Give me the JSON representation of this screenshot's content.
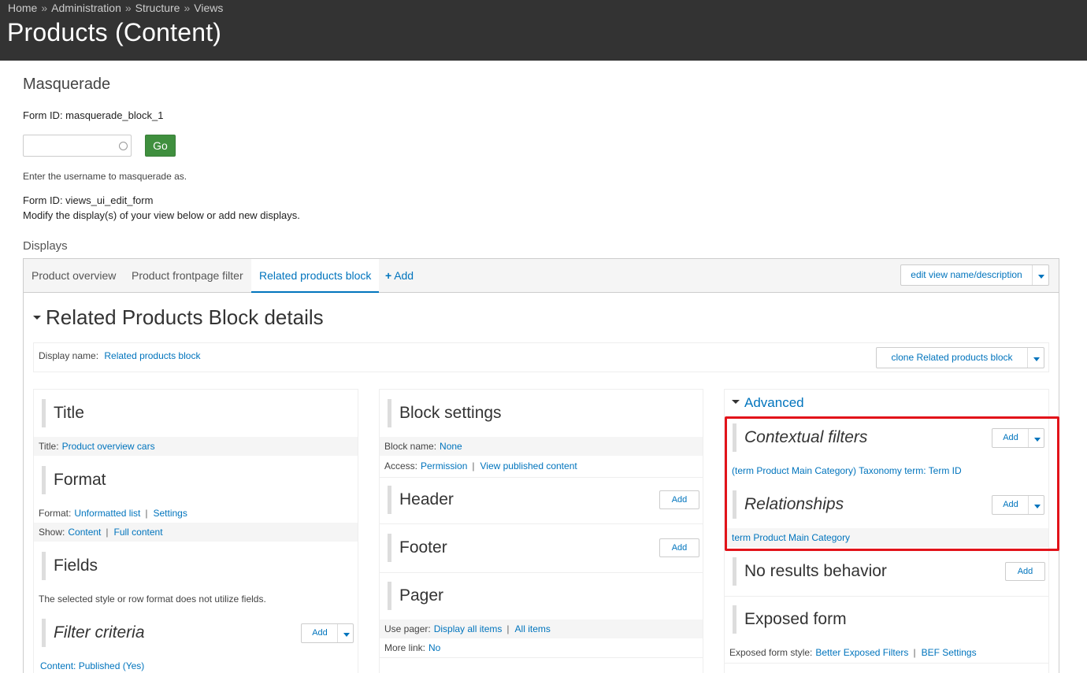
{
  "breadcrumb": [
    "Home",
    "Administration",
    "Structure",
    "Views"
  ],
  "breadcrumb_sep": "»",
  "page_title": "Products (Content)",
  "masquerade": {
    "heading": "Masquerade",
    "form_id": "Form ID: masquerade_block_1",
    "input_value": "",
    "go_label": "Go",
    "description": "Enter the username to masquerade as."
  },
  "views_form": {
    "form_id": "Form ID: views_ui_edit_form",
    "intro": "Modify the display(s) of your view below or add new displays."
  },
  "displays": {
    "heading": "Displays",
    "tabs": [
      "Product overview",
      "Product frontpage filter",
      "Related products block"
    ],
    "add_label": "Add",
    "edit_view_label": "edit view name/description"
  },
  "details": {
    "title": "Related Products Block details",
    "display_name_label": "Display name:",
    "display_name_value": "Related products block",
    "clone_label": "clone Related products block"
  },
  "col1": {
    "title_heading": "Title",
    "title_label": "Title:",
    "title_value": "Product overview cars",
    "format_heading": "Format",
    "format_label": "Format:",
    "format_value": "Unformatted list",
    "format_settings": "Settings",
    "show_label": "Show:",
    "show_value": "Content",
    "show_full": "Full content",
    "fields_heading": "Fields",
    "fields_note": "The selected style or row format does not utilize fields.",
    "filter_heading": "Filter criteria",
    "filter_add": "Add",
    "filter_item": "Content: Published (Yes)"
  },
  "col2": {
    "block_heading": "Block settings",
    "block_name_label": "Block name:",
    "block_name_value": "None",
    "access_label": "Access:",
    "access_value": "Permission",
    "access_perm": "View published content",
    "header_heading": "Header",
    "header_add": "Add",
    "footer_heading": "Footer",
    "footer_add": "Add",
    "pager_heading": "Pager",
    "pager_label": "Use pager:",
    "pager_value": "Display all items",
    "pager_all": "All items",
    "more_label": "More link:",
    "more_value": "No"
  },
  "col3": {
    "advanced_label": "Advanced",
    "contextual_heading": "Contextual filters",
    "contextual_add": "Add",
    "contextual_item": "(term Product Main Category) Taxonomy term: Term ID",
    "relationships_heading": "Relationships",
    "relationships_add": "Add",
    "relationships_item": "term Product Main Category",
    "noresults_heading": "No results behavior",
    "noresults_add": "Add",
    "exposed_heading": "Exposed form",
    "exposed_label": "Exposed form style:",
    "exposed_value": "Better Exposed Filters",
    "exposed_settings": "BEF Settings"
  },
  "colors": {
    "link": "#0074bd",
    "topbar": "#333333",
    "go_button": "#3f8f3e",
    "highlight": "#e2131a"
  }
}
